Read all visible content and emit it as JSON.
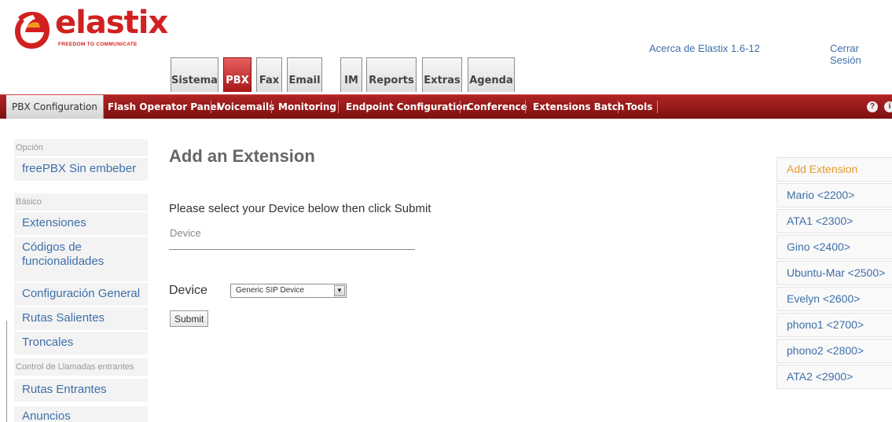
{
  "brand": {
    "name": "elastix",
    "tagline": "FREEDOM TO COMMUNICATE",
    "color": "#d22020"
  },
  "top_links": {
    "about": "Acerca de Elastix 1.6-12",
    "logout": "Cerrar Sesión"
  },
  "tabs": [
    {
      "label": "Sistema",
      "active": false
    },
    {
      "label": "PBX",
      "active": true
    },
    {
      "label": "Fax",
      "active": false
    },
    {
      "label": "Email",
      "active": false
    },
    {
      "label": "IM",
      "active": false
    },
    {
      "label": "Reports",
      "active": false
    },
    {
      "label": "Extras",
      "active": false
    },
    {
      "label": "Agenda",
      "active": false
    }
  ],
  "menu": [
    {
      "label": "PBX Configuration",
      "active": true
    },
    {
      "label": "Flash Operator Panel",
      "active": false
    },
    {
      "label": "Voicemails",
      "active": false
    },
    {
      "label": "Monitoring",
      "active": false
    },
    {
      "label": "Endpoint Configuration",
      "active": false
    },
    {
      "label": "Conference",
      "active": false
    },
    {
      "label": "Extensions Batch",
      "active": false
    },
    {
      "label": "Tools",
      "active": false
    }
  ],
  "menu_icons": [
    "help-icon",
    "info-icon"
  ],
  "left_nav": {
    "opcion_label": "Opción",
    "freepbx": "freePBX Sin embeber",
    "basico_label": "Básico",
    "extensiones": "Extensiones",
    "codigos_line1": "Códigos de",
    "codigos_line2": "funcionalidades",
    "config_general": "Configuración General",
    "rutas_salientes": "Rutas Salientes",
    "troncales": "Troncales",
    "control_label": "Control de Llamadas entrantes",
    "rutas_entrantes": "Rutas Entrantes",
    "anuncios": "Anuncios"
  },
  "main": {
    "title": "Add an Extension",
    "instruction": "Please select your Device below then click Submit",
    "section_label": "Device",
    "device_label": "Device",
    "device_value": "Generic SIP Device",
    "submit_label": "Submit"
  },
  "extensions": [
    {
      "label": "Add Extension",
      "current": true
    },
    {
      "label": "Mario <2200>",
      "current": false
    },
    {
      "label": "ATA1 <2300>",
      "current": false
    },
    {
      "label": "Gino <2400>",
      "current": false
    },
    {
      "label": "Ubuntu-Mar <2500>",
      "current": false
    },
    {
      "label": "Evelyn <2600>",
      "current": false
    },
    {
      "label": "phono1 <2700>",
      "current": false
    },
    {
      "label": "phono2 <2800>",
      "current": false
    },
    {
      "label": "ATA2 <2900>",
      "current": false
    }
  ],
  "colors": {
    "menubar": "#9a1a1a",
    "link": "#3f6fa8",
    "current_item": "#e59a2e"
  }
}
